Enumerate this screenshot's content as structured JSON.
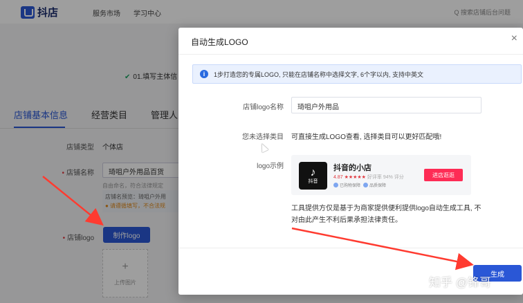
{
  "topbar": {
    "logo_text": "抖店",
    "nav": [
      "服务市场",
      "学习中心"
    ],
    "search_text": "Q 搜索店铺后台问题"
  },
  "background": {
    "step_text": "01.填写主体信",
    "tabs": [
      "店铺基本信息",
      "经营类目",
      "管理人员"
    ],
    "shop_type_label": "店铺类型",
    "shop_type_value": "个体店",
    "shop_name_label": "店铺名称",
    "shop_name_value": "琦咀户外用品百货",
    "name_hint": "自由命名，符合法律规定",
    "preview_text": "店铺名预览：琦咀户外用",
    "warn_text": "● 请遵循填写，不合法规",
    "shop_logo_label": "店铺logo",
    "make_logo_button": "制作logo",
    "upload_text": "上传图片",
    "upload_plus": "+"
  },
  "modal": {
    "title": "自动生成LOGO",
    "close": "×",
    "info_icon": "i",
    "info_text": "1步打造您的专属LOGO, 只能在店铺名称中选择文字, 6个字以内, 支持中英文",
    "name_label": "店铺logo名称",
    "name_value": "琦咀户外用品",
    "category_label": "您未选择类目",
    "category_text": "可直接生成LOGO查看, 选择类目可以更好匹配哦!",
    "sample_label": "logo示例",
    "sample": {
      "logo_note": "♪",
      "logo_name": "抖音",
      "shop_name": "抖音的小店",
      "rating": "4.87 ★★★★★",
      "rating_extra": "好评率 94% 评分",
      "badges": [
        "已购物保障",
        "品质保障"
      ],
      "enter_button": "进店逛逛"
    },
    "disclaimer": "工具提供方仅是基于为商家提供便利提供logo自动生成工具, 不对由此产生不利后果承担法律责任。",
    "confirm_button": "生成"
  },
  "watermark": "知乎 @锋哥",
  "colors": {
    "primary": "#2a57d6",
    "required": "#e0383e",
    "douyin_red": "#fe2c55",
    "annotation_arrow": "#ff3b30"
  }
}
